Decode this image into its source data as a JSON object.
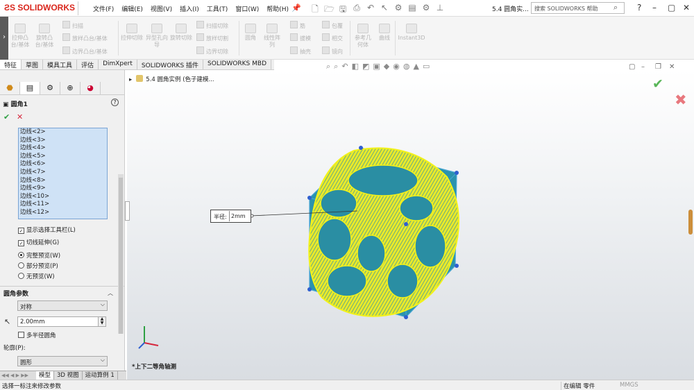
{
  "app": {
    "logo_text": "SOLIDWORKS",
    "document_title": "5.4 圆角实...",
    "search_placeholder": "搜索 SOLIDWORKS 帮助"
  },
  "menu": [
    "文件(F)",
    "编辑(E)",
    "视图(V)",
    "插入(I)",
    "工具(T)",
    "窗口(W)",
    "帮助(H)"
  ],
  "ribbon": {
    "buttons": [
      {
        "label": "拉伸凸台/基体"
      },
      {
        "label": "旋转凸台/基体"
      },
      {
        "label": "拉伸切除"
      },
      {
        "label": "异型孔向导"
      },
      {
        "label": "旋转切除"
      },
      {
        "label": "圆角"
      },
      {
        "label": "线性阵列"
      },
      {
        "label": "参考几何体"
      },
      {
        "label": "曲线"
      },
      {
        "label": "Instant3D"
      }
    ],
    "small": [
      "扫描",
      "放样凸台/基体",
      "边界凸台/基体",
      "扫描切除",
      "放样切割",
      "边界切除",
      "筋",
      "拔模",
      "抽壳",
      "包覆",
      "相交",
      "镜向"
    ]
  },
  "command_tabs": [
    "特征",
    "草图",
    "模具工具",
    "评估",
    "DimXpert",
    "SOLIDWORKS 插件",
    "SOLIDWORKS MBD"
  ],
  "panel": {
    "title": "圆角1",
    "edges": [
      "边线<2>",
      "边线<3>",
      "边线<4>",
      "边线<5>",
      "边线<6>",
      "边线<7>",
      "边线<8>",
      "边线<9>",
      "边线<10>",
      "边线<11>",
      "边线<12>"
    ],
    "opt_toolbar": "显示选择工具栏(L)",
    "opt_tangent": "切线延伸(G)",
    "opt_full": "完整预览(W)",
    "opt_partial": "部分预览(P)",
    "opt_none": "无预览(W)",
    "section_title": "圆角参数",
    "symmetric": "对称",
    "radius_value": "2.00mm",
    "multi_radius": "多半径圆角",
    "profile_label": "轮廓(P):",
    "profile_value": "圆形"
  },
  "tree": {
    "item": "5.4 圆角实例 (色子建模..."
  },
  "viewport": {
    "callout_key": "半径:",
    "callout_value": "2mm",
    "view_name": "*上下二等角轴测"
  },
  "bottom_tabs": [
    "模型",
    "3D 视图",
    "运动算例 1"
  ],
  "status": {
    "message": "选择一标注来修改参数",
    "mode": "在编辑 零件",
    "units": "MMGS"
  },
  "colors": {
    "accent": "#d9261c",
    "selection": "#cfe2f6",
    "model_face": "#2b8fa6",
    "fillet_edge": "#f2f21a"
  }
}
